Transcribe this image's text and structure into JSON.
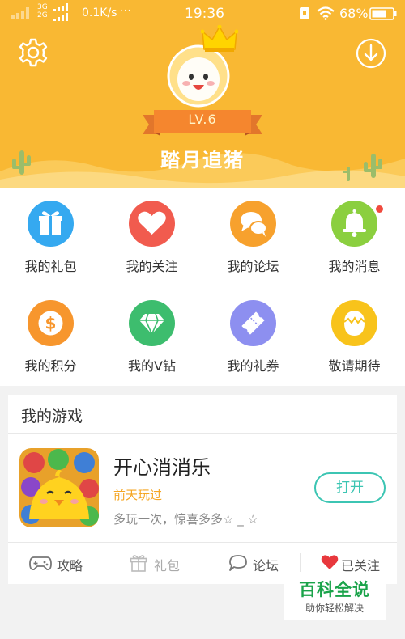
{
  "status_bar": {
    "network_type": "3G 2G",
    "speed": "0.1K/s",
    "more": "···",
    "time": "19:36",
    "battery": "68%"
  },
  "profile": {
    "level": "LV.6",
    "username": "踏月追猪"
  },
  "menu": [
    {
      "label": "我的礼包",
      "icon": "gift-icon",
      "color": "#35a9f0"
    },
    {
      "label": "我的关注",
      "icon": "heart-icon",
      "color": "#f15b4e"
    },
    {
      "label": "我的论坛",
      "icon": "chat-bubbles-icon",
      "color": "#f7a12d"
    },
    {
      "label": "我的消息",
      "icon": "bell-icon",
      "color": "#8bcf3f"
    },
    {
      "label": "我的积分",
      "icon": "dollar-icon",
      "color": "#f7962d"
    },
    {
      "label": "我的V钻",
      "icon": "diamond-icon",
      "color": "#3dbd6e"
    },
    {
      "label": "我的礼券",
      "icon": "ticket-icon",
      "color": "#8d8ff0"
    },
    {
      "label": "敬请期待",
      "icon": "egg-icon",
      "color": "#f8c31b"
    }
  ],
  "my_games": {
    "title": "我的游戏",
    "game": {
      "name": "开心消消乐",
      "last_played": "前天玩过",
      "description": "多玩一次，惊喜多多☆ _ ☆",
      "open_label": "打开"
    },
    "actions": [
      {
        "label": "攻略",
        "icon": "gamepad-icon"
      },
      {
        "label": "礼包",
        "icon": "gift-outline-icon"
      },
      {
        "label": "论坛",
        "icon": "chat-outline-icon"
      },
      {
        "label": "已关注",
        "icon": "heart-filled-icon"
      }
    ]
  },
  "watermark": {
    "title": "百科全说",
    "subtitle": "助你轻松解决"
  },
  "colors": {
    "header_bg": "#f9b833",
    "accent_teal": "#3cc5b3",
    "last_played": "#f5a623",
    "follow_heart": "#e8383d"
  }
}
